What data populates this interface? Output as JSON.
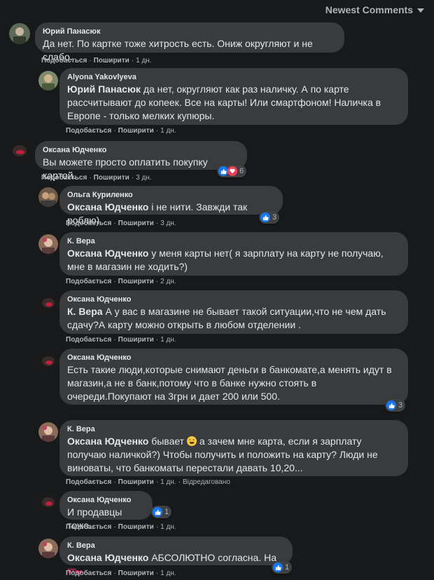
{
  "sort": {
    "label": "Newest Comments"
  },
  "actions": {
    "like": "Подобається",
    "share": "Поширити",
    "edited": "Відредаговано"
  },
  "comments": [
    {
      "author": "Юрий Панасюк",
      "text": "Да нет. По картке тоже хитрость есть. Ониж округляют и не слабо.",
      "time": "1 дн."
    },
    {
      "author": "Alyona Yakovlyeva",
      "mention": "Юрий Панасюк",
      "text": " да нет, округляют как раз наличку. А по карте рассчитывают до копеек. Все на карты! Или смартфоном! Наличка в Европе - только мелких купюры.",
      "time": "1 дн."
    },
    {
      "author": "Оксана Юдченко",
      "text": "Вы можете просто оплатить покупку картой.",
      "time": "3 дн.",
      "reactions": "6"
    },
    {
      "author": "Ольга Куриленко",
      "mention": "Оксана Юдченко",
      "text": " і не нити. Завжди так роблю)",
      "time": "3 дн.",
      "reactions": "3"
    },
    {
      "author": "К. Вера",
      "mention": "Оксана Юдченко",
      "text": " у меня карты нет( я зарплату на карту не получаю, мне в магазин не ходить?)",
      "time": "2 дн."
    },
    {
      "author": "Оксана Юдченко",
      "mention": "К. Вера",
      "text": " А у вас в магазине не бывает такой ситуации,что не чем дать сдачу?А карту можно открыть в любом отделении .",
      "time": "1 дн."
    },
    {
      "author": "Оксана Юдченко",
      "text": "Есть такие люди,которые снимают деньги в банкомате,а менять идут в магазин,а не в банк,потому что в банке нужно стоять в очереди.Покупают на 3грн и дает 200 или 500.",
      "time": "1 дн.",
      "reactions": "3"
    },
    {
      "author": "К. Вера",
      "mention": "Оксана Юдченко",
      "text_a": " бывает ",
      "text_b": " а зачем мне карта, если я зарплату получаю наличкой?) Чтобы получить и положить на карту? Люди не виноваты, что банкоматы перестали давать 10,20...",
      "time": "1 дн."
    },
    {
      "author": "Оксана Юдченко",
      "text": "И продавцы тоже..",
      "time": "1 дн.",
      "reactions": "1"
    },
    {
      "author": "К. Вера",
      "mention": "Оксана Юдченко",
      "text": " АБСОЛЮТНО согласна. На",
      "emoji_100": "100",
      "time": "1 дн.",
      "reactions": "1"
    }
  ]
}
